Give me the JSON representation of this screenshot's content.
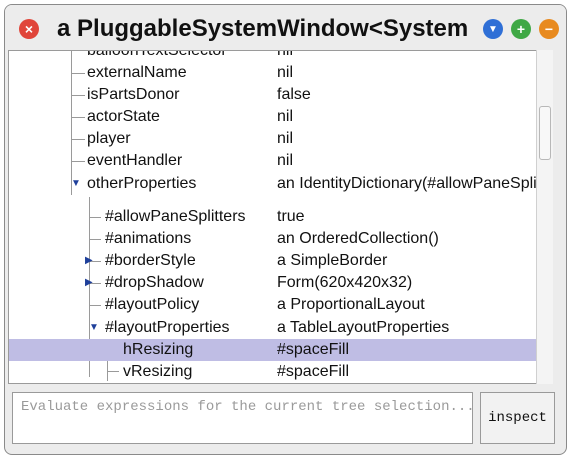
{
  "window": {
    "title": "a PluggableSystemWindow<System B",
    "close_glyph": "×",
    "menu_glyph": "▼",
    "expand_glyph": "+",
    "collapse_glyph": "−"
  },
  "tree": {
    "rows": [
      {
        "name": "balloonTextSelector",
        "value": "nil"
      },
      {
        "name": "externalName",
        "value": "nil"
      },
      {
        "name": "isPartsDonor",
        "value": "false"
      },
      {
        "name": "actorState",
        "value": "nil"
      },
      {
        "name": "player",
        "value": "nil"
      },
      {
        "name": "eventHandler",
        "value": "nil"
      },
      {
        "name": "otherProperties",
        "value": "an IdentityDictionary(#allowPaneSplitters->true"
      },
      {
        "name": "#allowPaneSplitters",
        "value": "true"
      },
      {
        "name": "#animations",
        "value": "an OrderedCollection()"
      },
      {
        "name": "#borderStyle",
        "value": "a SimpleBorder"
      },
      {
        "name": "#dropShadow",
        "value": "Form(620x420x32)"
      },
      {
        "name": "#layoutPolicy",
        "value": "a ProportionalLayout"
      },
      {
        "name": "#layoutProperties",
        "value": "a TableLayoutProperties"
      },
      {
        "name": "hResizing",
        "value": "#spaceFill"
      },
      {
        "name": "vResizing",
        "value": "#spaceFill"
      }
    ],
    "arrow_expanded": "▼",
    "arrow_collapsed": "▶"
  },
  "evaluator": {
    "placeholder": "Evaluate expressions for the current tree selection..."
  },
  "inspect_button": {
    "label": "inspect"
  }
}
